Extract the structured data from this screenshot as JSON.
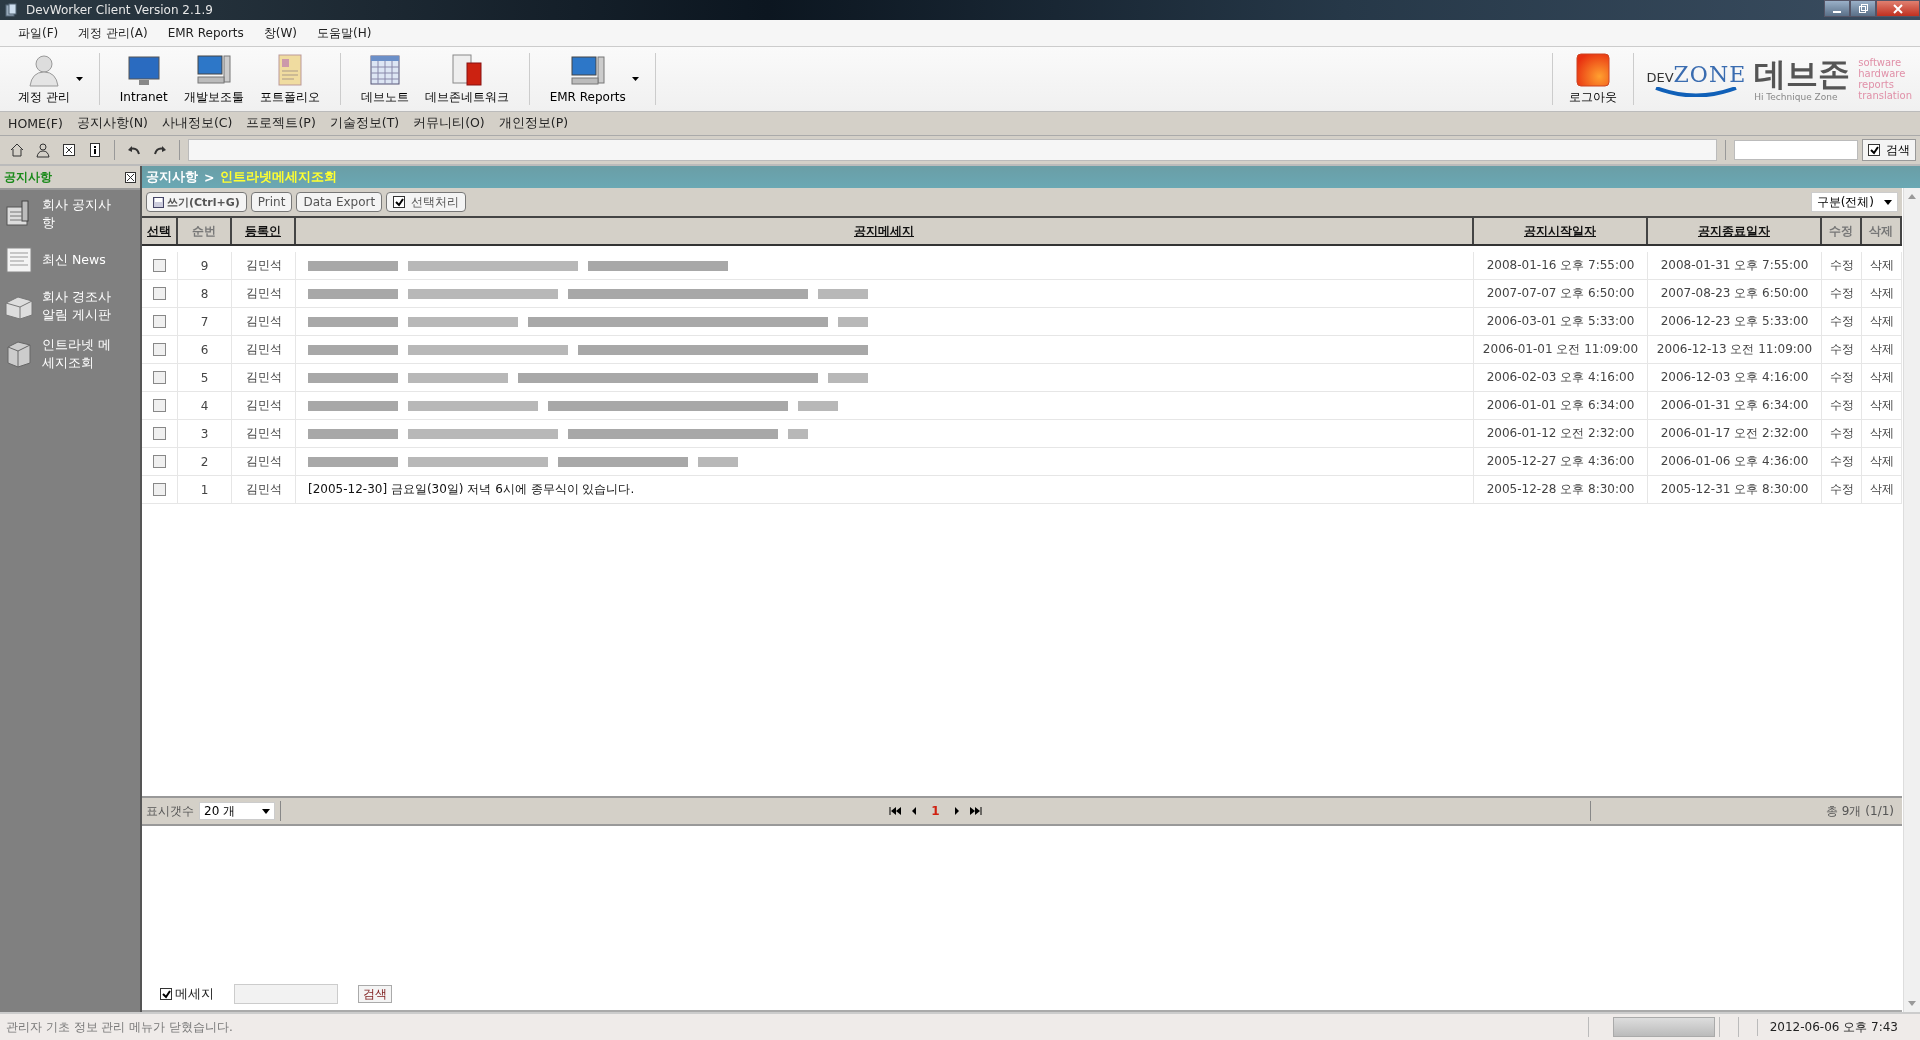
{
  "window": {
    "title": "DevWorker Client Version 2.1.9"
  },
  "menu_bar": [
    "파일(F)",
    "계정 관리(A)",
    "EMR Reports",
    "창(W)",
    "도움말(H)"
  ],
  "toolbar": [
    [
      {
        "label": "계정 관리",
        "kind": "person",
        "has_menu": true
      }
    ],
    [
      {
        "label": "Intranet",
        "kind": "monitor",
        "has_menu": false
      },
      {
        "label": "개발보조툴",
        "kind": "computer",
        "has_menu": false
      },
      {
        "label": "포트폴리오",
        "kind": "document",
        "has_menu": false
      }
    ],
    [
      {
        "label": "데브노트",
        "kind": "calendar",
        "has_menu": false
      },
      {
        "label": "데브존네트워크",
        "kind": "server",
        "has_menu": false
      }
    ],
    [
      {
        "label": "EMR Reports",
        "kind": "computer",
        "has_menu": true
      }
    ]
  ],
  "logout": {
    "label": "로그아웃"
  },
  "logo": {
    "prefix": "DEV",
    "name": "ZONE",
    "korean": "데브존",
    "tagline": "Hi Technique Zone",
    "keywords": [
      "software",
      "hardware",
      "reports",
      "translation"
    ]
  },
  "nav_menu": [
    "HOME(F)",
    "공지사항(N)",
    "사내정보(C)",
    "프로젝트(P)",
    "기술정보(T)",
    "커뮤니티(O)",
    "개인정보(P)"
  ],
  "quick_toolbar": {
    "tools": [
      {
        "kind": "home"
      },
      {
        "kind": "user"
      },
      {
        "kind": "close"
      },
      {
        "kind": "info"
      },
      {
        "kind": "undo"
      },
      {
        "kind": "redo"
      }
    ],
    "search_button": {
      "label": "검색",
      "checked": true
    }
  },
  "sidebar": {
    "title": "공지사항",
    "items": [
      {
        "label": "회사 공지사항",
        "kind": "notice"
      },
      {
        "label": "최신 News",
        "kind": "news"
      },
      {
        "label": "회사 경조사 알림 게시판",
        "kind": "box"
      },
      {
        "label": "인트라넷 메세지조회",
        "kind": "message"
      }
    ]
  },
  "breadcrumb": {
    "parent": "공지사항",
    "separator": ">",
    "current": "인트라넷메세지조회"
  },
  "actions": [
    {
      "label": "쓰기(Ctrl+G)",
      "kind": "write"
    },
    {
      "label": "Print",
      "kind": "plain"
    },
    {
      "label": "Data Export",
      "kind": "plain"
    },
    {
      "label": "선택처리",
      "kind": "check",
      "checked": true
    }
  ],
  "category_filter": "구분(전체)",
  "table": {
    "columns": [
      {
        "label": "선택",
        "sortable": true
      },
      {
        "label": "순번",
        "sortable": false
      },
      {
        "label": "등록인",
        "sortable": true
      },
      {
        "label": "공지메세지",
        "sortable": true
      },
      {
        "label": "공지시작일자",
        "sortable": true
      },
      {
        "label": "공지종료일자",
        "sortable": true
      },
      {
        "label": "수정",
        "sortable": false
      },
      {
        "label": "삭제",
        "sortable": false
      }
    ],
    "rows": [
      {
        "checked": false,
        "number": "9",
        "author": "김민석",
        "blurred": true,
        "start": "2008-01-16 오후 7:55:00",
        "end": "2008-01-31 오후 7:55:00",
        "edit": "수정",
        "delete": "삭제"
      },
      {
        "checked": false,
        "number": "8",
        "author": "김민석",
        "blurred": true,
        "start": "2007-07-07 오후 6:50:00",
        "end": "2007-08-23 오후 6:50:00",
        "edit": "수정",
        "delete": "삭제"
      },
      {
        "checked": false,
        "number": "7",
        "author": "김민석",
        "blurred": true,
        "start": "2006-03-01 오후 5:33:00",
        "end": "2006-12-23 오후 5:33:00",
        "edit": "수정",
        "delete": "삭제"
      },
      {
        "checked": false,
        "number": "6",
        "author": "김민석",
        "blurred": true,
        "start": "2006-01-01 오전 11:09:00",
        "end": "2006-12-13 오전 11:09:00",
        "edit": "수정",
        "delete": "삭제"
      },
      {
        "checked": false,
        "number": "5",
        "author": "김민석",
        "blurred": true,
        "start": "2006-02-03 오후 4:16:00",
        "end": "2006-12-03 오후 4:16:00",
        "edit": "수정",
        "delete": "삭제"
      },
      {
        "checked": false,
        "number": "4",
        "author": "김민석",
        "blurred": true,
        "start": "2006-01-01 오후 6:34:00",
        "end": "2006-01-31 오후 6:34:00",
        "edit": "수정",
        "delete": "삭제"
      },
      {
        "checked": false,
        "number": "3",
        "author": "김민석",
        "blurred": true,
        "start": "2006-01-12 오전 2:32:00",
        "end": "2006-01-17 오전 2:32:00",
        "edit": "수정",
        "delete": "삭제"
      },
      {
        "checked": false,
        "number": "2",
        "author": "김민석",
        "blurred": true,
        "start": "2005-12-27 오후 4:36:00",
        "end": "2006-01-06 오후 4:36:00",
        "edit": "수정",
        "delete": "삭제"
      },
      {
        "checked": false,
        "number": "1",
        "author": "김민석",
        "blurred": false,
        "message": "[2005-12-30] 금요일(30일) 저녁 6시에 종무식이 있습니다.",
        "start": "2005-12-28 오후 8:30:00",
        "end": "2005-12-31 오후 8:30:00",
        "edit": "수정",
        "delete": "삭제"
      }
    ]
  },
  "pager": {
    "page_size_label": "표시갯수",
    "page_size": "20 개",
    "pages": [
      {
        "label": "1",
        "selected": true
      }
    ],
    "total": "총 9개 (1/1)"
  },
  "message_search": {
    "label": "메세지",
    "checked": true,
    "button": "검색"
  },
  "status_bar": {
    "message": "관리자 기초 정보 관리 메뉴가 닫혔습니다.",
    "datetime": "2012-06-06 오후 7:43"
  }
}
